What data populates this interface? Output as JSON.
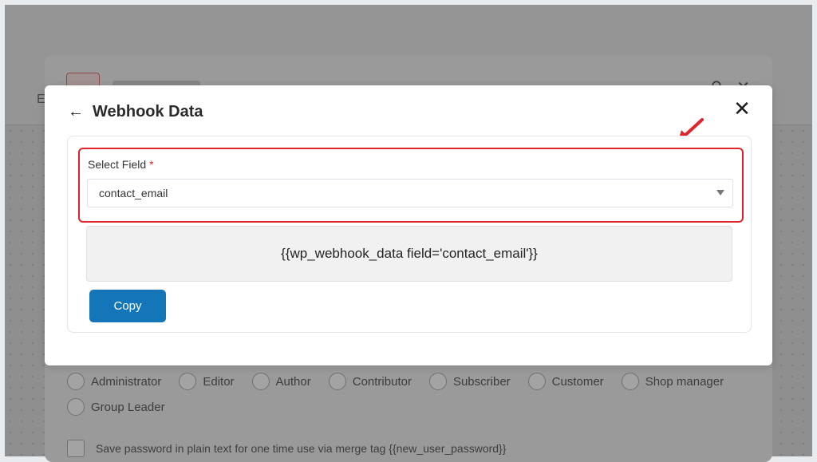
{
  "background": {
    "edge_text": "E",
    "roles": [
      "Administrator",
      "Editor",
      "Author",
      "Contributor",
      "Subscriber",
      "Customer",
      "Shop manager",
      "Group Leader"
    ],
    "password_option_label": "Save password in plain text for one time use via merge tag {{new_user_password}}"
  },
  "modal": {
    "title": "Webhook Data",
    "back_icon": "arrow-left-icon",
    "close_icon": "close-icon",
    "field_label": "Select Field",
    "required_marker": "*",
    "select_value": "contact_email",
    "merge_tag": "{{wp_webhook_data field='contact_email'}}",
    "copy_label": "Copy"
  },
  "colors": {
    "primary_button": "#1476b8",
    "highlight": "#e0242b",
    "overlay": "#8f8f8f"
  }
}
